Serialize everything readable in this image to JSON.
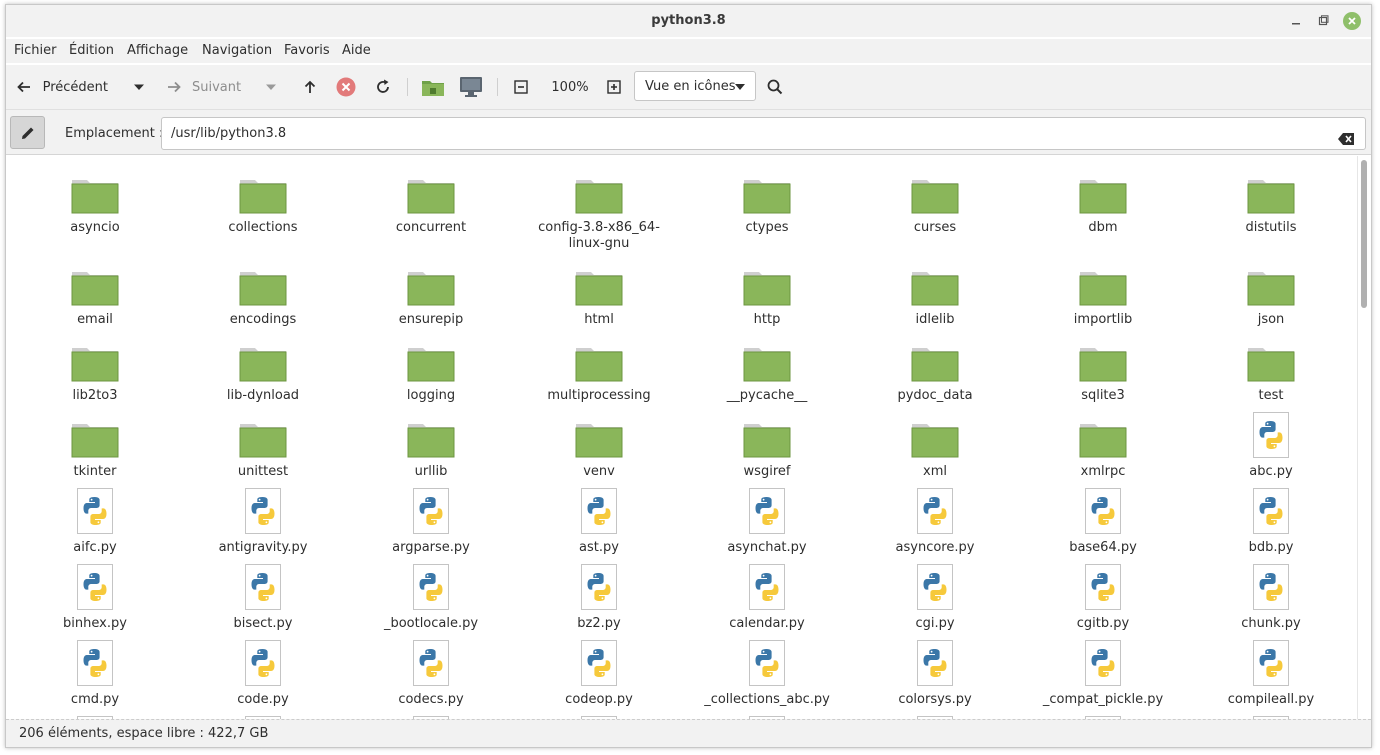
{
  "window": {
    "title": "python3.8"
  },
  "menu": [
    "Fichier",
    "Édition",
    "Affichage",
    "Navigation",
    "Favoris",
    "Aide"
  ],
  "toolbar": {
    "back_label": "Précédent",
    "forward_label": "Suivant",
    "zoom": "100%",
    "view_mode": "Vue en icônes"
  },
  "location": {
    "label": "Emplacement :",
    "path": "/usr/lib/python3.8"
  },
  "colors": {
    "folder": "#8ab65a",
    "close_button": "#8fbf6a"
  },
  "items": [
    {
      "name": "asyncio",
      "type": "folder"
    },
    {
      "name": "collections",
      "type": "folder"
    },
    {
      "name": "concurrent",
      "type": "folder"
    },
    {
      "name": "config-3.8-x86_64-linux-gnu",
      "type": "folder"
    },
    {
      "name": "ctypes",
      "type": "folder"
    },
    {
      "name": "curses",
      "type": "folder"
    },
    {
      "name": "dbm",
      "type": "folder"
    },
    {
      "name": "distutils",
      "type": "folder"
    },
    {
      "name": "email",
      "type": "folder"
    },
    {
      "name": "encodings",
      "type": "folder"
    },
    {
      "name": "ensurepip",
      "type": "folder"
    },
    {
      "name": "html",
      "type": "folder"
    },
    {
      "name": "http",
      "type": "folder"
    },
    {
      "name": "idlelib",
      "type": "folder"
    },
    {
      "name": "importlib",
      "type": "folder"
    },
    {
      "name": "json",
      "type": "folder"
    },
    {
      "name": "lib2to3",
      "type": "folder"
    },
    {
      "name": "lib-dynload",
      "type": "folder"
    },
    {
      "name": "logging",
      "type": "folder"
    },
    {
      "name": "multiprocessing",
      "type": "folder"
    },
    {
      "name": "__pycache__",
      "type": "folder"
    },
    {
      "name": "pydoc_data",
      "type": "folder"
    },
    {
      "name": "sqlite3",
      "type": "folder"
    },
    {
      "name": "test",
      "type": "folder"
    },
    {
      "name": "tkinter",
      "type": "folder"
    },
    {
      "name": "unittest",
      "type": "folder"
    },
    {
      "name": "urllib",
      "type": "folder"
    },
    {
      "name": "venv",
      "type": "folder"
    },
    {
      "name": "wsgiref",
      "type": "folder"
    },
    {
      "name": "xml",
      "type": "folder"
    },
    {
      "name": "xmlrpc",
      "type": "folder"
    },
    {
      "name": "abc.py",
      "type": "python"
    },
    {
      "name": "aifc.py",
      "type": "python"
    },
    {
      "name": "antigravity.py",
      "type": "python"
    },
    {
      "name": "argparse.py",
      "type": "python"
    },
    {
      "name": "ast.py",
      "type": "python"
    },
    {
      "name": "asynchat.py",
      "type": "python"
    },
    {
      "name": "asyncore.py",
      "type": "python"
    },
    {
      "name": "base64.py",
      "type": "python"
    },
    {
      "name": "bdb.py",
      "type": "python"
    },
    {
      "name": "binhex.py",
      "type": "python"
    },
    {
      "name": "bisect.py",
      "type": "python"
    },
    {
      "name": "_bootlocale.py",
      "type": "python"
    },
    {
      "name": "bz2.py",
      "type": "python"
    },
    {
      "name": "calendar.py",
      "type": "python"
    },
    {
      "name": "cgi.py",
      "type": "python"
    },
    {
      "name": "cgitb.py",
      "type": "python"
    },
    {
      "name": "chunk.py",
      "type": "python"
    },
    {
      "name": "cmd.py",
      "type": "python"
    },
    {
      "name": "code.py",
      "type": "python"
    },
    {
      "name": "codecs.py",
      "type": "python"
    },
    {
      "name": "codeop.py",
      "type": "python"
    },
    {
      "name": "_collections_abc.py",
      "type": "python"
    },
    {
      "name": "colorsys.py",
      "type": "python"
    },
    {
      "name": "_compat_pickle.py",
      "type": "python"
    },
    {
      "name": "compileall.py",
      "type": "python"
    },
    {
      "name": "",
      "type": "python"
    },
    {
      "name": "",
      "type": "python"
    },
    {
      "name": "",
      "type": "python"
    },
    {
      "name": "",
      "type": "python"
    },
    {
      "name": "",
      "type": "python"
    },
    {
      "name": "",
      "type": "python"
    },
    {
      "name": "",
      "type": "python"
    },
    {
      "name": "",
      "type": "python"
    }
  ],
  "status": {
    "text": "206 éléments, espace libre : 422,7 GB"
  }
}
